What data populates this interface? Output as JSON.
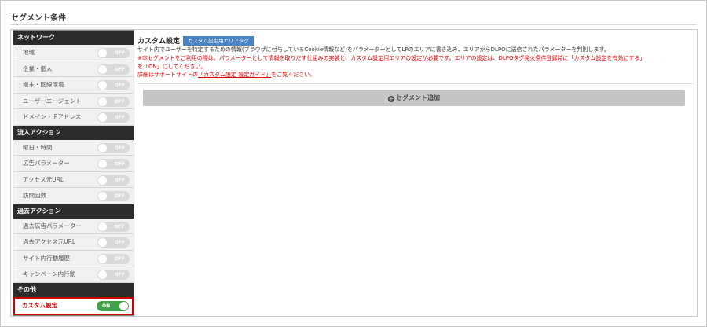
{
  "page": {
    "title": "セグメント条件"
  },
  "sidebar": {
    "groups": [
      {
        "title": "ネットワーク",
        "items": [
          {
            "label": "地域",
            "state": "OFF"
          },
          {
            "label": "企業・個人",
            "state": "OFF"
          },
          {
            "label": "端末・回線環境",
            "state": "OFF"
          },
          {
            "label": "ユーザーエージェント",
            "state": "OFF"
          },
          {
            "label": "ドメイン・IPアドレス",
            "state": "OFF"
          }
        ]
      },
      {
        "title": "流入アクション",
        "items": [
          {
            "label": "曜日・時間",
            "state": "OFF"
          },
          {
            "label": "広告パラメーター",
            "state": "OFF"
          },
          {
            "label": "アクセス元URL",
            "state": "OFF"
          },
          {
            "label": "訪問回数",
            "state": "OFF"
          }
        ]
      },
      {
        "title": "過去アクション",
        "items": [
          {
            "label": "過去広告パラメーター",
            "state": "OFF"
          },
          {
            "label": "過去アクセス元URL",
            "state": "OFF"
          },
          {
            "label": "サイト内行動履歴",
            "state": "OFF"
          },
          {
            "label": "キャンペーン内行動",
            "state": "OFF"
          }
        ]
      },
      {
        "title": "その他",
        "items": [
          {
            "label": "カスタム設定",
            "state": "ON"
          }
        ]
      }
    ]
  },
  "content": {
    "title": "カスタム設定",
    "badge": "カスタム設定用エリアタグ",
    "description": "サイト内でユーザーを特定するための情報(ブラウザに付与しているCookie情報など)をパラメーターとしてLPのエリアに書き込み、エリアからDLPOに送信されたパラメーターを判別します。",
    "notice_line1": "※本セグメントをご利用の際は、パラメーターとして情報を取りだす仕組みの実装と、カスタム設定用エリアの設定が必要です。エリアの設定は、DLPOタグ発火条件登録時に「カスタム設定を有効にする」",
    "notice_line2": "を「ON」にしてください。",
    "guide_prefix": "詳細はサポートサイトの",
    "guide_link": "「カスタム設定 設定ガイド」",
    "guide_suffix": "をご覧ください。",
    "add_button": "セグメント追加"
  },
  "colors": {
    "on": "#43a047",
    "off": "#d9d9d9",
    "header": "#2b2b2b",
    "badge": "#4a82c6",
    "alert": "#e00000"
  }
}
